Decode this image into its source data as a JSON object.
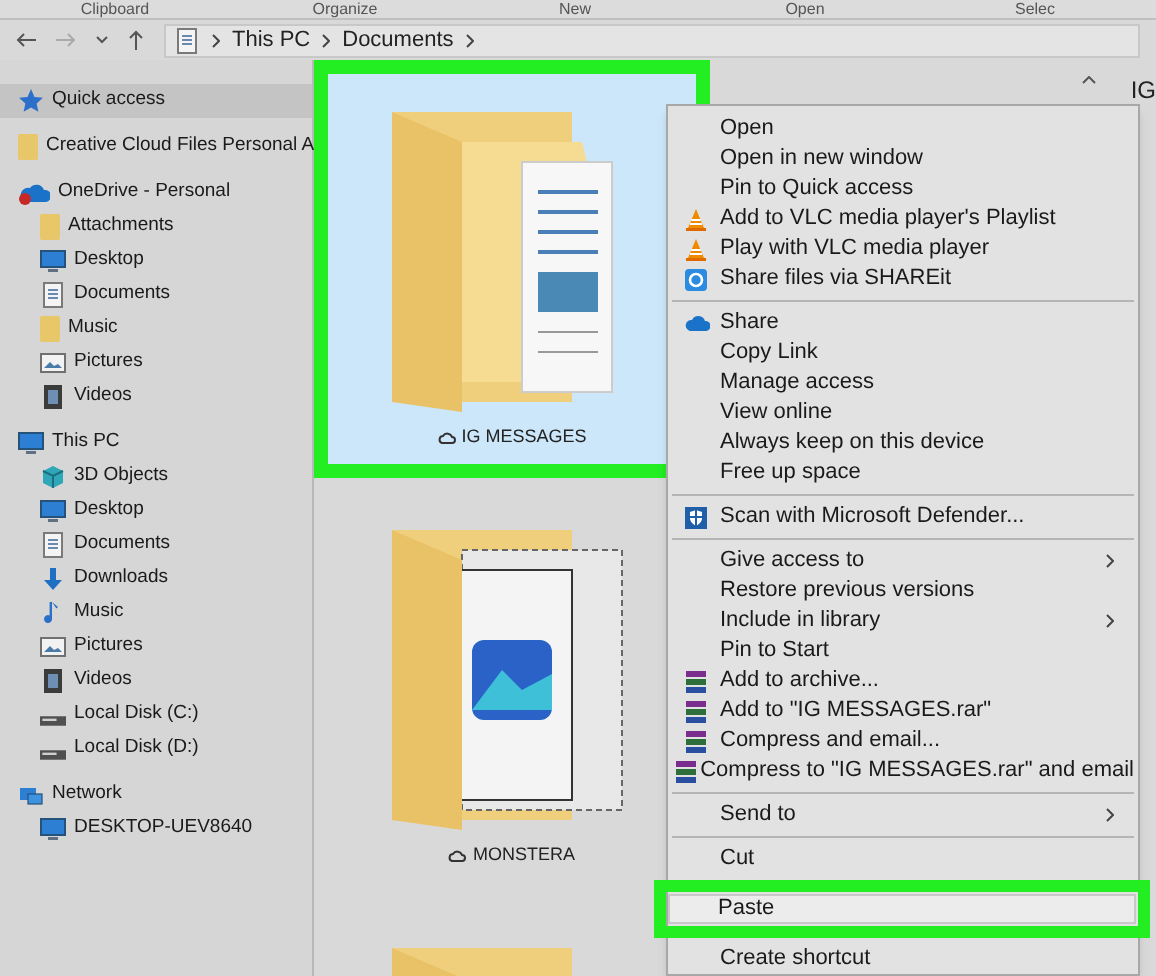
{
  "ribbon": {
    "groups": [
      "Clipboard",
      "Organize",
      "New",
      "Open",
      "Selec"
    ]
  },
  "address_bar": {
    "path": [
      "This PC",
      "Documents"
    ]
  },
  "sidebar": {
    "items": [
      {
        "label": "Quick access",
        "kind": "star",
        "selected": true
      },
      {
        "label": "Creative Cloud Files Personal A",
        "kind": "folder",
        "selected": false
      },
      {
        "label": "OneDrive - Personal",
        "kind": "cloud",
        "selected": false,
        "children": [
          {
            "label": "Attachments",
            "kind": "folder",
            "selected": false
          },
          {
            "label": "Desktop",
            "kind": "desktop",
            "selected": false
          },
          {
            "label": "Documents",
            "kind": "documents",
            "selected": false
          },
          {
            "label": "Music",
            "kind": "folder",
            "selected": false
          },
          {
            "label": "Pictures",
            "kind": "pictures",
            "selected": false
          },
          {
            "label": "Videos",
            "kind": "videos",
            "selected": false
          }
        ]
      },
      {
        "label": "This PC",
        "kind": "pc",
        "selected": false,
        "children": [
          {
            "label": "3D Objects",
            "kind": "cube",
            "selected": false
          },
          {
            "label": "Desktop",
            "kind": "desktop",
            "selected": false
          },
          {
            "label": "Documents",
            "kind": "documents",
            "selected": false
          },
          {
            "label": "Downloads",
            "kind": "downloads",
            "selected": false
          },
          {
            "label": "Music",
            "kind": "music",
            "selected": false
          },
          {
            "label": "Pictures",
            "kind": "pictures",
            "selected": false
          },
          {
            "label": "Videos",
            "kind": "videos",
            "selected": false
          },
          {
            "label": "Local Disk (C:)",
            "kind": "drive",
            "selected": false
          },
          {
            "label": "Local Disk (D:)",
            "kind": "drive",
            "selected": false
          }
        ]
      },
      {
        "label": "Network",
        "kind": "network",
        "selected": false,
        "children": [
          {
            "label": "DESKTOP-UEV8640",
            "kind": "desktop",
            "selected": false
          }
        ]
      }
    ]
  },
  "files": [
    {
      "name": "IG MESSAGES",
      "kind": "documents",
      "selected": true,
      "highlighted": true
    },
    {
      "name": "MONSTERA",
      "kind": "pictures",
      "selected": false,
      "highlighted": false
    },
    {
      "kind": "plain",
      "selected": false,
      "highlighted": false
    }
  ],
  "details_pane": {
    "title": "IG"
  },
  "context_menu": {
    "groups": [
      [
        {
          "label": "Open",
          "kind": "none"
        },
        {
          "label": "Open in new window",
          "kind": "none"
        },
        {
          "label": "Pin to Quick access",
          "kind": "none"
        },
        {
          "label": "Add to VLC media player's Playlist",
          "kind": "vlc"
        },
        {
          "label": "Play with VLC media player",
          "kind": "vlc"
        },
        {
          "label": "Share files via SHAREit",
          "kind": "shareit"
        }
      ],
      [
        {
          "label": "Share",
          "kind": "onedrive"
        },
        {
          "label": "Copy Link",
          "kind": "none"
        },
        {
          "label": "Manage access",
          "kind": "none"
        },
        {
          "label": "View online",
          "kind": "none"
        },
        {
          "label": "Always keep on this device",
          "kind": "none"
        },
        {
          "label": "Free up space",
          "kind": "none"
        }
      ],
      [
        {
          "label": "Scan with Microsoft Defender...",
          "kind": "defender"
        }
      ],
      [
        {
          "label": "Give access to",
          "kind": "none",
          "submenu": true
        },
        {
          "label": "Restore previous versions",
          "kind": "none"
        },
        {
          "label": "Include in library",
          "kind": "none",
          "submenu": true
        },
        {
          "label": "Pin to Start",
          "kind": "none"
        },
        {
          "label": "Add to archive...",
          "kind": "winrar"
        },
        {
          "label": "Add to \"IG MESSAGES.rar\"",
          "kind": "winrar"
        },
        {
          "label": "Compress and email...",
          "kind": "winrar"
        },
        {
          "label": "Compress to \"IG MESSAGES.rar\" and email",
          "kind": "winrar"
        }
      ],
      [
        {
          "label": "Send to",
          "kind": "none",
          "submenu": true
        }
      ],
      [
        {
          "label": "Cut",
          "kind": "none"
        },
        {
          "label": "Paste",
          "kind": "none",
          "highlighted": true
        },
        {
          "label": "Create shortcut",
          "kind": "none"
        }
      ]
    ]
  }
}
